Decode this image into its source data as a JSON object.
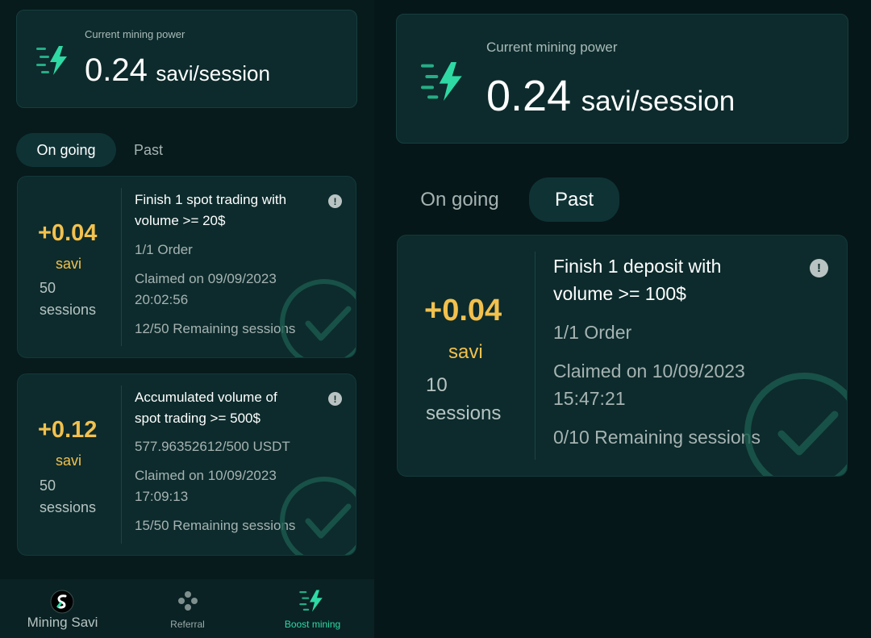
{
  "left": {
    "power": {
      "caption": "Current mining power",
      "value": "0.24",
      "unit": "savi/session"
    },
    "tabs": [
      {
        "label": "On going",
        "active": true
      },
      {
        "label": "Past",
        "active": false
      }
    ],
    "tasks": [
      {
        "reward": "+0.04",
        "unit": "savi",
        "sessions_count": "50",
        "sessions_label": "sessions",
        "title_line1": "Finish 1 spot trading with",
        "title_line2": "volume >= 20$",
        "progress": "1/1 Order",
        "claimed_line1": "Claimed on 09/09/2023",
        "claimed_line2": "20:02:56",
        "remaining": "12/50 Remaining sessions",
        "info": "!"
      },
      {
        "reward": "+0.12",
        "unit": "savi",
        "sessions_count": "50",
        "sessions_label": "sessions",
        "title_line1": "Accumulated volume of",
        "title_line2": "spot trading >= 500$",
        "progress": "577.96352612/500 USDT",
        "claimed_line1": "Claimed on 10/09/2023",
        "claimed_line2": "17:09:13",
        "remaining": "15/50 Remaining sessions",
        "info": "!"
      }
    ],
    "nav": [
      {
        "label": "Mining Savi",
        "icon": "savi-logo-icon",
        "active": false
      },
      {
        "label": "Referral",
        "icon": "referral-icon",
        "active": false
      },
      {
        "label": "Boost mining",
        "icon": "bolt-icon",
        "active": true
      }
    ]
  },
  "right": {
    "power": {
      "caption": "Current mining power",
      "value": "0.24",
      "unit": "savi/session"
    },
    "tabs": [
      {
        "label": "On going",
        "active": false
      },
      {
        "label": "Past",
        "active": true
      }
    ],
    "tasks": [
      {
        "reward": "+0.04",
        "unit": "savi",
        "sessions_count": "10",
        "sessions_label": "sessions",
        "title_line1": "Finish 1 deposit with",
        "title_line2": "volume >= 100$",
        "progress": "1/1 Order",
        "claimed_line1": "Claimed on 10/09/2023",
        "claimed_line2": "15:47:21",
        "remaining": "0/10 Remaining sessions",
        "info": "!"
      }
    ]
  },
  "colors": {
    "accent": "#2fd9a4",
    "reward": "#f2c14e",
    "card": "#0d2b2c",
    "background": "#08191b"
  }
}
